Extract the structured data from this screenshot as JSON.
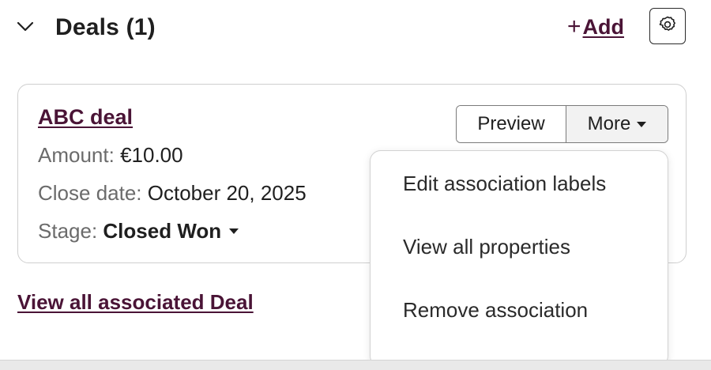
{
  "header": {
    "title": "Deals (1)",
    "add_plus": "+",
    "add_label": "Add",
    "collapse_icon": "chevron-down-icon",
    "settings_icon": "gear-icon"
  },
  "card": {
    "deal_name": "ABC deal",
    "amount_label": "Amount:",
    "amount_value": "€10.00",
    "close_label": "Close date:",
    "close_value": "October 20, 2025",
    "stage_label": "Stage:",
    "stage_value": "Closed Won",
    "preview_label": "Preview",
    "more_label": "More"
  },
  "more_menu": {
    "items": [
      {
        "label": "Edit association labels"
      },
      {
        "label": "View all properties"
      },
      {
        "label": "Remove association"
      }
    ]
  },
  "footer": {
    "view_all_label": "View all associated Deal"
  },
  "colors": {
    "link": "#4a1436",
    "text": "#1f1f1f",
    "muted": "#6b6b6b",
    "border": "#cfcfcf"
  }
}
